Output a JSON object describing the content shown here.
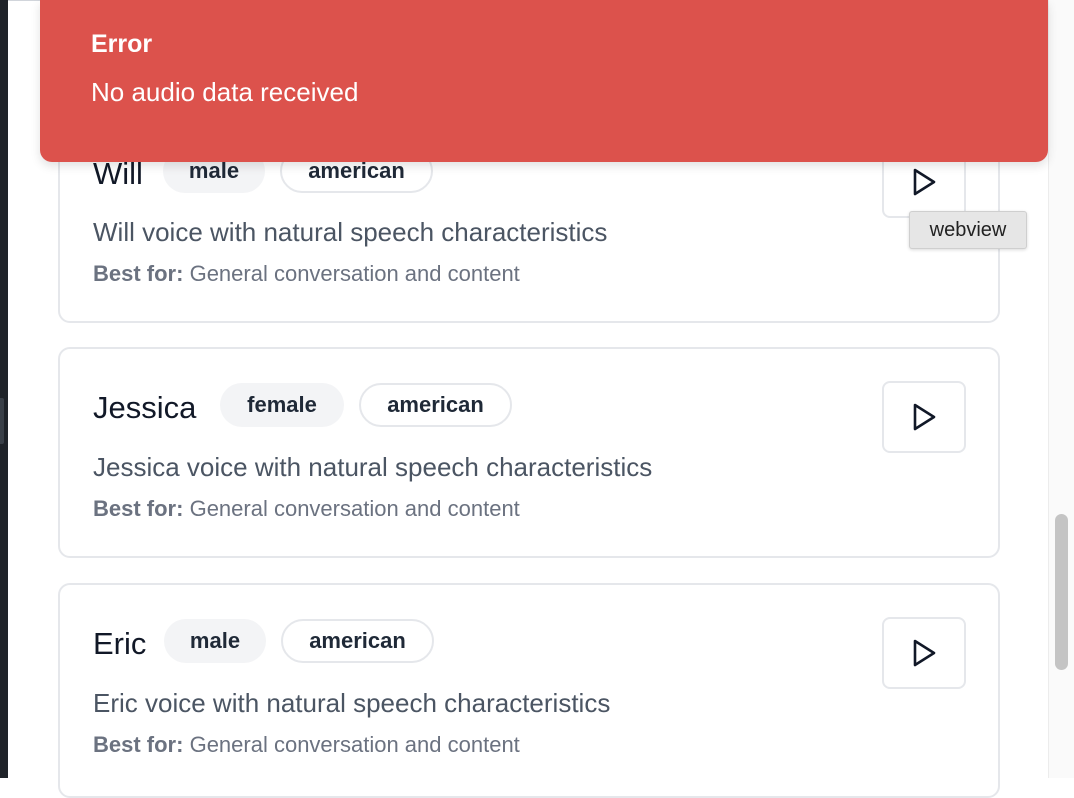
{
  "toast": {
    "title": "Error",
    "message": "No audio data received",
    "color": "#dc524c"
  },
  "tooltip": {
    "text": "webview"
  },
  "voices": [
    {
      "name": "Will",
      "gender": "male",
      "accent": "american",
      "description": "Will voice with natural speech characteristics",
      "best_for_label": "Best for:",
      "best_for": "General conversation and content"
    },
    {
      "name": "Jessica",
      "gender": "female",
      "accent": "american",
      "description": "Jessica voice with natural speech characteristics",
      "best_for_label": "Best for:",
      "best_for": "General conversation and content"
    },
    {
      "name": "Eric",
      "gender": "male",
      "accent": "american",
      "description": "Eric voice with natural speech characteristics",
      "best_for_label": "Best for:",
      "best_for": "General conversation and content"
    }
  ],
  "icons": {
    "play": "play-icon"
  }
}
